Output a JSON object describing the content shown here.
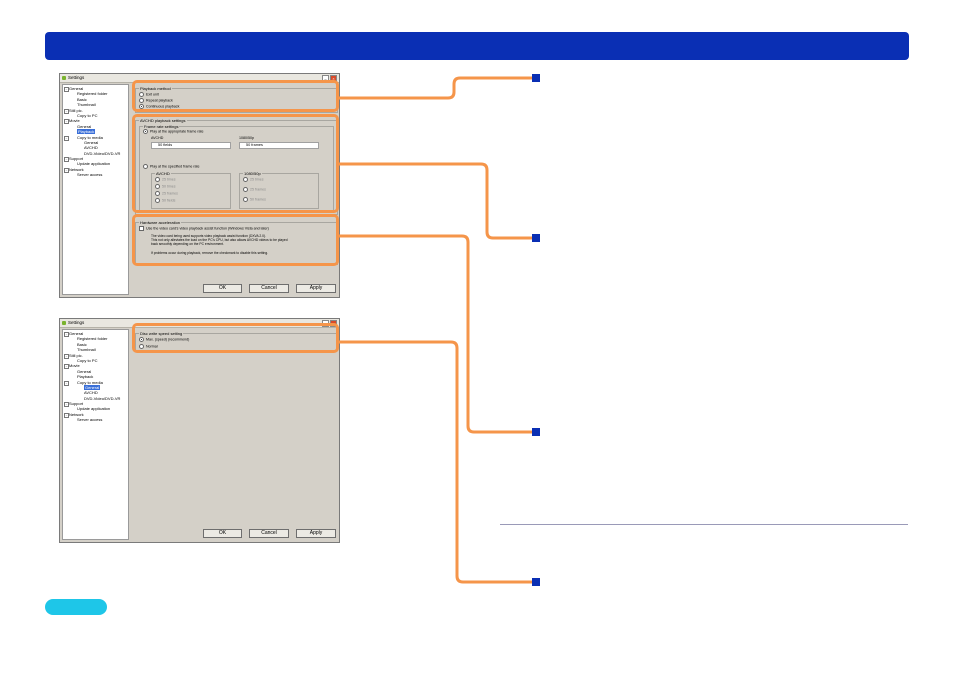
{
  "header_bar": {},
  "screenshot1": {
    "title": "Settings",
    "tree": [
      {
        "label": "General",
        "level": 0,
        "toggle": "−"
      },
      {
        "label": "Registered folder",
        "level": 1
      },
      {
        "label": "Basic",
        "level": 1
      },
      {
        "label": "Thumbnail",
        "level": 1
      },
      {
        "label": "Still pic.",
        "level": 0,
        "toggle": "−"
      },
      {
        "label": "Copy to PC",
        "level": 1
      },
      {
        "label": "Movie",
        "level": 0,
        "toggle": "−"
      },
      {
        "label": "General",
        "level": 1
      },
      {
        "label": "Playback",
        "level": 1,
        "selected": true
      },
      {
        "label": "Copy to media",
        "level": 1,
        "toggle": "−"
      },
      {
        "label": "General",
        "level": 2
      },
      {
        "label": "AVCHD",
        "level": 2
      },
      {
        "label": "DVD-Video/DVD-VR",
        "level": 2
      },
      {
        "label": "Support",
        "level": 0,
        "toggle": "−"
      },
      {
        "label": "Update application",
        "level": 1
      },
      {
        "label": "Network",
        "level": 0,
        "toggle": "−"
      },
      {
        "label": "Server access",
        "level": 1
      }
    ],
    "playback_method": {
      "caption": "Playback method",
      "options": [
        "Exit unit",
        "Repeat playback",
        "Continuous playback"
      ],
      "selected": 2
    },
    "avchd_settings": {
      "caption": "AVCHD playback settings",
      "frame_rate_caption": "Frame rate settings",
      "opt_appropriate": "Play at the appropriate frame rate",
      "avchd_label": "AVCHD",
      "avchd_value": "50 fields",
      "p50_label": "1080/50p",
      "p50_value": "50 frames",
      "opt_specified": "Play at the specified frame rate",
      "specified_avchd_label": "AVCHD",
      "specified_avchd_options": [
        "25 times",
        "50 times",
        "25 frames",
        "50 fields"
      ],
      "specified_p50_label": "1080/50p",
      "specified_p50_options": [
        "25 times",
        "25 frames",
        "50 frames"
      ]
    },
    "hw_accel": {
      "caption": "Hardware acceleration",
      "check_label": "Use the video card's video playback assist function (Windows Vista and later)",
      "desc1": "The video card being used supports video playback assist function (DXVA 2.0).",
      "desc2": "This not only alleviates the load on the PC's CPU, but also allows AVCHD videos to be played",
      "desc3": "back smoothly depending on the PC environment.",
      "desc4": "If problems occur during playback, remove the checkmark to disable this setting."
    },
    "buttons": {
      "ok": "OK",
      "cancel": "Cancel",
      "apply": "Apply"
    }
  },
  "screenshot2": {
    "title": "Settings",
    "tree": [
      {
        "label": "General",
        "level": 0,
        "toggle": "−"
      },
      {
        "label": "Registered folder",
        "level": 1
      },
      {
        "label": "Basic",
        "level": 1
      },
      {
        "label": "Thumbnail",
        "level": 1
      },
      {
        "label": "Still pic.",
        "level": 0,
        "toggle": "−"
      },
      {
        "label": "Copy to PC",
        "level": 1
      },
      {
        "label": "Movie",
        "level": 0,
        "toggle": "−"
      },
      {
        "label": "General",
        "level": 1
      },
      {
        "label": "Playback",
        "level": 1
      },
      {
        "label": "Copy to media",
        "level": 1,
        "toggle": "−"
      },
      {
        "label": "General",
        "level": 2,
        "selected": true
      },
      {
        "label": "AVCHD",
        "level": 2
      },
      {
        "label": "DVD-Video/DVD-VR",
        "level": 2
      },
      {
        "label": "Support",
        "level": 0,
        "toggle": "−"
      },
      {
        "label": "Update application",
        "level": 1
      },
      {
        "label": "Network",
        "level": 0,
        "toggle": "−"
      },
      {
        "label": "Server access",
        "level": 1
      }
    ],
    "disc_speed": {
      "caption": "Disc write speed setting",
      "options": [
        "Max. (speed) (recommend)",
        "Normal"
      ],
      "selected": 0
    },
    "buttons": {
      "ok": "OK",
      "cancel": "Cancel",
      "apply": "Apply"
    }
  },
  "colors": {
    "header": "#0a2fb4",
    "highlight": "#f5954a",
    "marker": "#0a2fb4",
    "pill": "#1ec6e8",
    "dialog_bg": "#d4d0c8"
  }
}
